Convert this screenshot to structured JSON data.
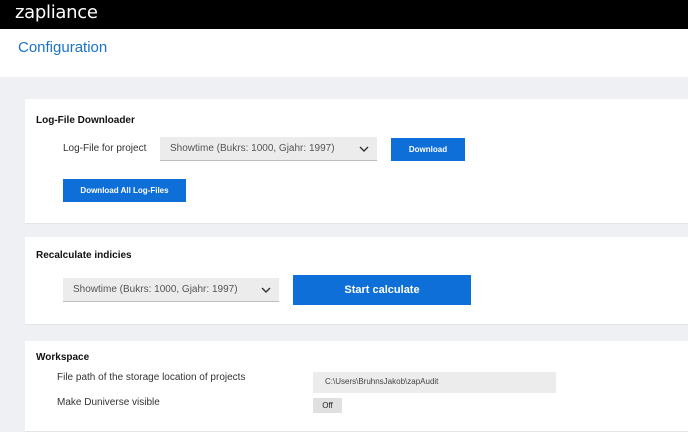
{
  "app": {
    "logo": "zapliance"
  },
  "page": {
    "title": "Configuration"
  },
  "logfile_section": {
    "title": "Log-File Downloader",
    "project_label": "Log-File for project",
    "project_select_value": "Showtime (Bukrs: 1000, Gjahr: 1997)",
    "download_label": "Download",
    "download_all_label": "Download All Log-Files"
  },
  "recalc_section": {
    "title": "Recalculate indicies",
    "project_select_value": "Showtime (Bukrs: 1000, Gjahr: 1997)",
    "start_label": "Start calculate"
  },
  "workspace_section": {
    "title": "Workspace",
    "path_label": "File path of the storage location of projects",
    "path_value": "C:\\Users\\BruhnsJakob\\zapAudit",
    "duniverse_label": "Make Duniverse visible",
    "duniverse_toggle": "Off"
  },
  "icons": {
    "select_chevron": "chevron-down-icon"
  },
  "colors": {
    "topbar": "#000000",
    "accent": "#0f6fd8",
    "title": "#1a73c8",
    "background": "#eef0f3"
  }
}
